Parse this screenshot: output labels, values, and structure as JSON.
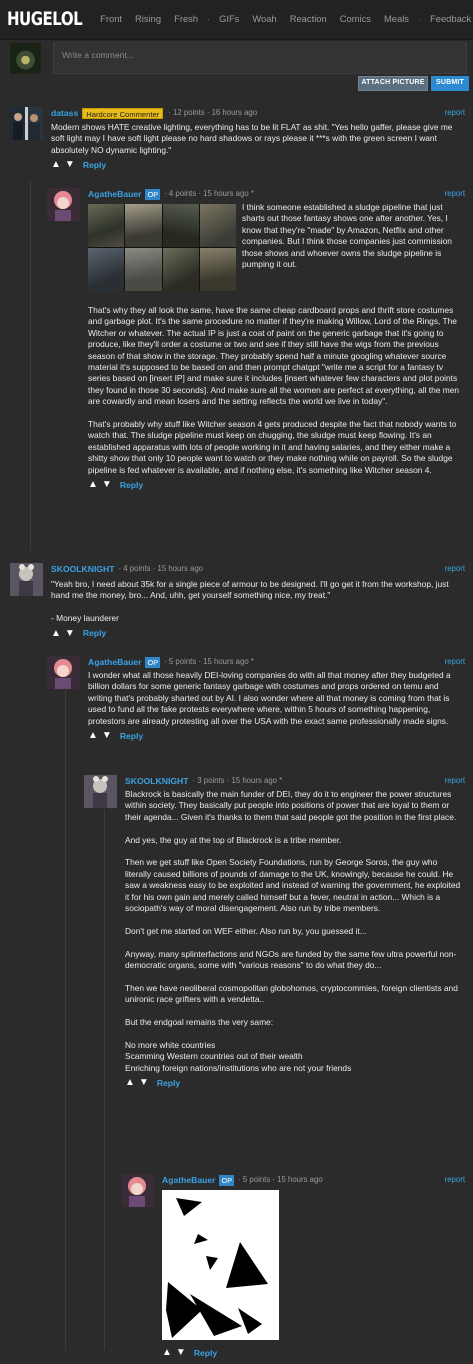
{
  "nav": {
    "logo": "HUGELOL",
    "links": [
      "Front",
      "Rising",
      "Fresh",
      "GIFs",
      "Woah",
      "Reaction",
      "Comics",
      "Meals",
      "Feedback"
    ],
    "separator": "·"
  },
  "composer": {
    "placeholder": "Write a comment...",
    "attach_label": "ATTACH PICTURE",
    "submit_label": "SUBMIT"
  },
  "comments": [
    {
      "user": "datass",
      "badge": "Hardcore Commenter",
      "meta": "· 12 points · 16 hours ago",
      "report": "report",
      "paragraphs": [
        "Modern shows HATE creative lighting, everything has to be lit FLAT as shit. \"Yes hello gaffer, please give me soft light may I have soft light please no hard shadows or rays please it ***s with the green screen I want absolutely NO dynamic lighting.\""
      ],
      "reply": "Reply"
    },
    {
      "user": "AgatheBauer",
      "badge": "OP",
      "meta": "· 4 points · 15 hours ago *",
      "report": "report",
      "lead": "I think someone established a sludge pipeline that just sharts out those fantasy shows one after another. Yes, I know that they're \"made\" by Amazon, Netflix and other companies. But I think those companies just commission those shows and whoever owns the sludge pipeline is pumping it out.",
      "paragraphs": [
        "That's why they all look the same, have the same cheap cardboard props and thrift store costumes and garbage plot. It's the same procedure no matter if they're making Willow, Lord of the Rings, The Witcher or whatever. The actual IP is just a coat of paint on the generic garbage that it's going to produce, like they'll order a costume or two and see if they still have the wigs from the previous season of that show in the storage. They probably spend half a minute googling whatever source material it's supposed to be based on and then prompt chatgpt \"write me a script for a fantasy tv series based on [insert IP] and make sure it includes [insert whatever few characters and plot points they found in those 30 seconds]. And make sure all the women are perfect at everything, all the men are cowardly and mean losers and the setting reflects the world we live in today\".",
        "That's probably why stuff like Witcher season 4 gets produced despite the fact that nobody wants to watch that. The sludge pipeline must keep on chugging, the sludge must keep flowing. It's an established apparatus with lots of people working in it and having salaries, and they either make a shitty show that only 10 people want to watch or they make nothing while on payroll. So the sludge pipeline is fed whatever is available, and if nothing else, it's something like Witcher season 4."
      ],
      "reply": "Reply"
    },
    {
      "user": "SKOOLKNIGHT",
      "badge": "",
      "meta": "· 4 points · 15 hours ago",
      "report": "report",
      "paragraphs": [
        "\"Yeah bro, I need about 35k for a single piece of armour to be designed. I'll go get it from the workshop, just hand me the money, bro... And, uhh, get yourself something nice, my treat.\"",
        "- Money launderer"
      ],
      "reply": "Reply"
    },
    {
      "user": "AgatheBauer",
      "badge": "OP",
      "meta": "· 5 points · 15 hours ago *",
      "report": "report",
      "paragraphs": [
        "I wonder what all those heavily DEI-loving companies do with all that money after they budgeted a billion dollars for some generic fantasy garbage with costumes and props ordered on temu and writing that's probably sharted out by AI. I also wonder where all that money is coming from that is used to fund all the fake protests everywhere where, within 5 hours of something happening, protestors are already protesting all over the USA with the exact same professionally made signs."
      ],
      "reply": "Reply"
    },
    {
      "user": "SKOOLKNIGHT",
      "badge": "",
      "meta": "· 3 points · 15 hours ago *",
      "report": "report",
      "paragraphs": [
        "Blackrock is basically the main funder of DEI, they do it to engineer the power structures within society. They basically put people into positions of power that are loyal to them or their agenda... Given it's thanks to them that said people got the position in the first place.",
        "And yes, the guy at the top of Blackrock is a tribe member.",
        "Then we get stuff like Open Society Foundations, run by George Soros, the guy who literally caused billions of pounds of damage to the UK, knowingly, because he could. He saw a weakness easy to be exploited and instead of warning the government, he exploited it for his own gain and merely called himself but a fever, neutral in action... Which is a sociopath's way of moral disengagement. Also run by tribe members.",
        "Don't get me started on WEF either. Also run by, you guessed it...",
        "Anyway, many splinterfactions and NGOs are funded by the same few ultra powerful non-democratic organs, some with \"various reasons\" to do what they do...",
        "Then we have neoliberal cosmopolitan globohomos, cryptocommies, foreign clientists and unironic race grifters with a vendetta..",
        "But the endgoal remains the very same:"
      ],
      "list": [
        "No more white countries",
        "Scamming Western countries out of their wealth",
        "Enriching foreign nations/institutions who are not your friends"
      ],
      "reply": "Reply"
    },
    {
      "user": "AgatheBauer",
      "badge": "OP",
      "meta": "· 5 points · 15 hours ago",
      "report": "report",
      "reply": "Reply"
    }
  ],
  "icons": {
    "upvote": "▲",
    "downvote": "▼"
  }
}
